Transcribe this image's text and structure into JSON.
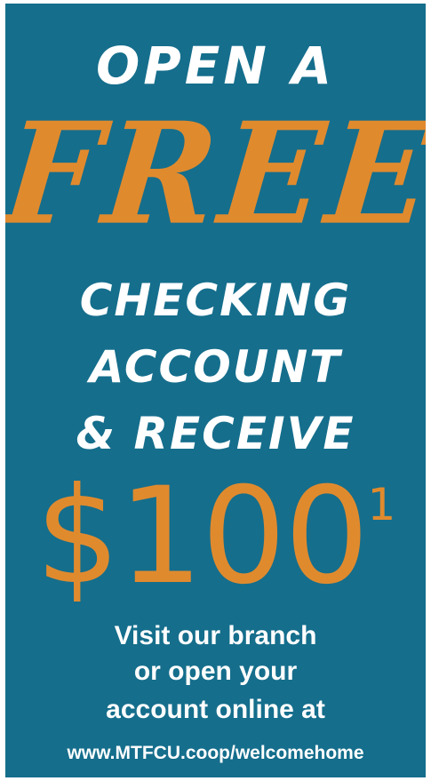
{
  "colors": {
    "background": "#156e8c",
    "accent": "#e08a2e",
    "text": "#ffffff"
  },
  "ad": {
    "line1": "OPEN A",
    "highlight": "FREE",
    "line3": "CHECKING",
    "line4": "ACCOUNT",
    "line5": "& RECEIVE",
    "amount": "$100",
    "footnote_marker": "1",
    "cta_line1": "Visit our branch",
    "cta_line2": "or open your",
    "cta_line3": "account online at",
    "url": "www.MTFCU.coop/welcomehome"
  }
}
